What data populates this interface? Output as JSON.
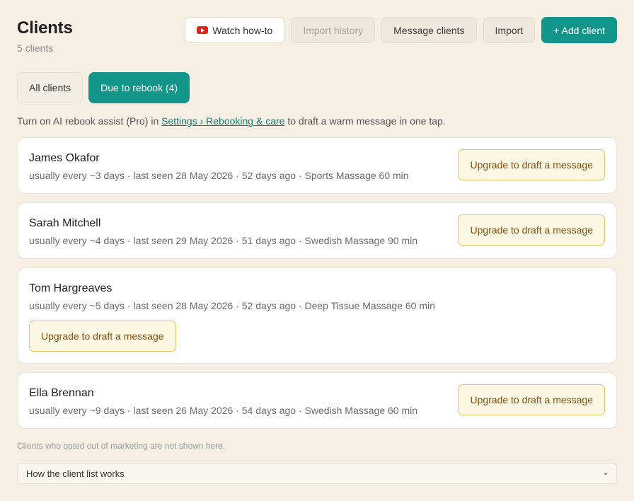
{
  "page": {
    "title": "Clients",
    "subtitle": "5 clients"
  },
  "toolbar": {
    "watch_label": "Watch how-to",
    "import_history_label": "Import history",
    "message_clients_label": "Message clients",
    "import_label": "Import",
    "add_client_label": "+ Add client"
  },
  "tabs": [
    {
      "label": "All clients",
      "active": false
    },
    {
      "label": "Due to rebook (4)",
      "active": true
    }
  ],
  "notice": {
    "before": "Turn on AI rebook assist (Pro) in ",
    "link": "Settings › Rebooking & care",
    "after": " to draft a warm message in one tap."
  },
  "clients": [
    {
      "name": "James Okafor",
      "meta": "usually every ~3 days · last seen 28 May 2026 · 52 days ago · Sports Massage 60 min",
      "action": "Upgrade to draft a message"
    },
    {
      "name": "Sarah Mitchell",
      "meta": "usually every ~4 days · last seen 29 May 2026 · 51 days ago · Swedish Massage 90 min",
      "action": "Upgrade to draft a message"
    },
    {
      "name": "Tom Hargreaves",
      "meta": "usually every ~5 days · last seen 28 May 2026 · 52 days ago · Deep Tissue Massage 60 min",
      "action": "Upgrade to draft a message"
    },
    {
      "name": "Ella Brennan",
      "meta": "usually every ~9 days · last seen 26 May 2026 · 54 days ago · Swedish Massage 60 min",
      "action": "Upgrade to draft a message"
    }
  ],
  "footer": {
    "note": "Clients who opted out of marketing are not shown here.",
    "accordion_label": "How the client list works"
  },
  "colors": {
    "accent": "#13968a",
    "background": "#f5efe4",
    "upgrade_border": "#e8c766",
    "upgrade_text": "#8a4d0a"
  }
}
